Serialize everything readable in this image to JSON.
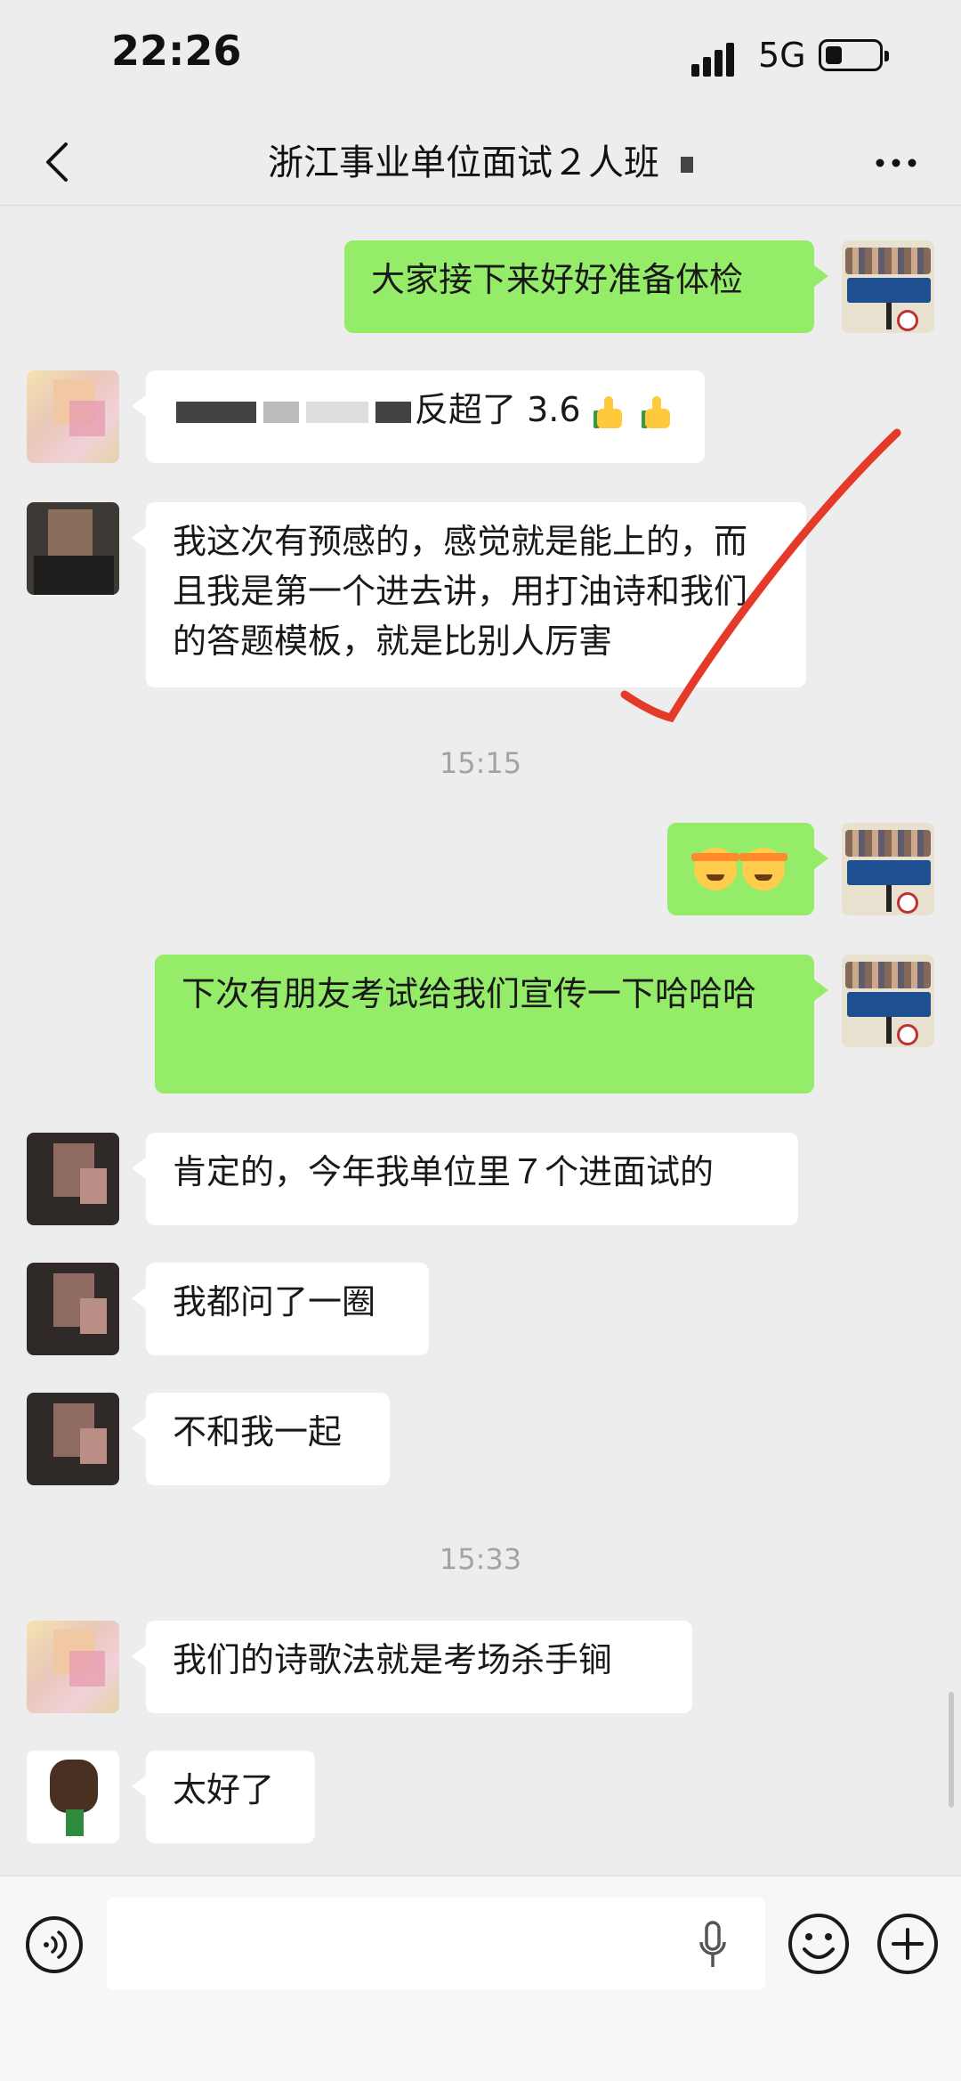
{
  "status_bar": {
    "time": "22:26",
    "network": "5G",
    "battery_fraction": 0.3
  },
  "nav": {
    "title": "浙江事业单位面试２人班"
  },
  "messages": {
    "m1": "大家接下来好好准备体检",
    "m2_suffix": "反超了 3.6",
    "m3": "我这次有预感的，感觉就是能上的，而且我是第一个进去讲，用打油诗和我们的答题模板，就是比别人厉害",
    "m5": "下次有朋友考试给我们宣传一下哈哈哈",
    "m6": "肯定的，今年我单位里７个进面试的",
    "m7": "我都问了一圈",
    "m8": "不和我一起",
    "m9": "我们的诗歌法就是考场杀手锏",
    "m10": "太好了"
  },
  "timestamps": {
    "t1": "15:15",
    "t2": "15:33"
  },
  "colors": {
    "self_bubble": "#95ec69",
    "other_bubble": "#ffffff",
    "background": "#ededed",
    "annotation": "#e53a2a"
  },
  "icons": {
    "back": "chevron-left-icon",
    "more": "more-dots-icon",
    "voice": "voice-icon",
    "emoji": "smile-icon",
    "add": "plus-icon",
    "mic": "mic-icon"
  }
}
